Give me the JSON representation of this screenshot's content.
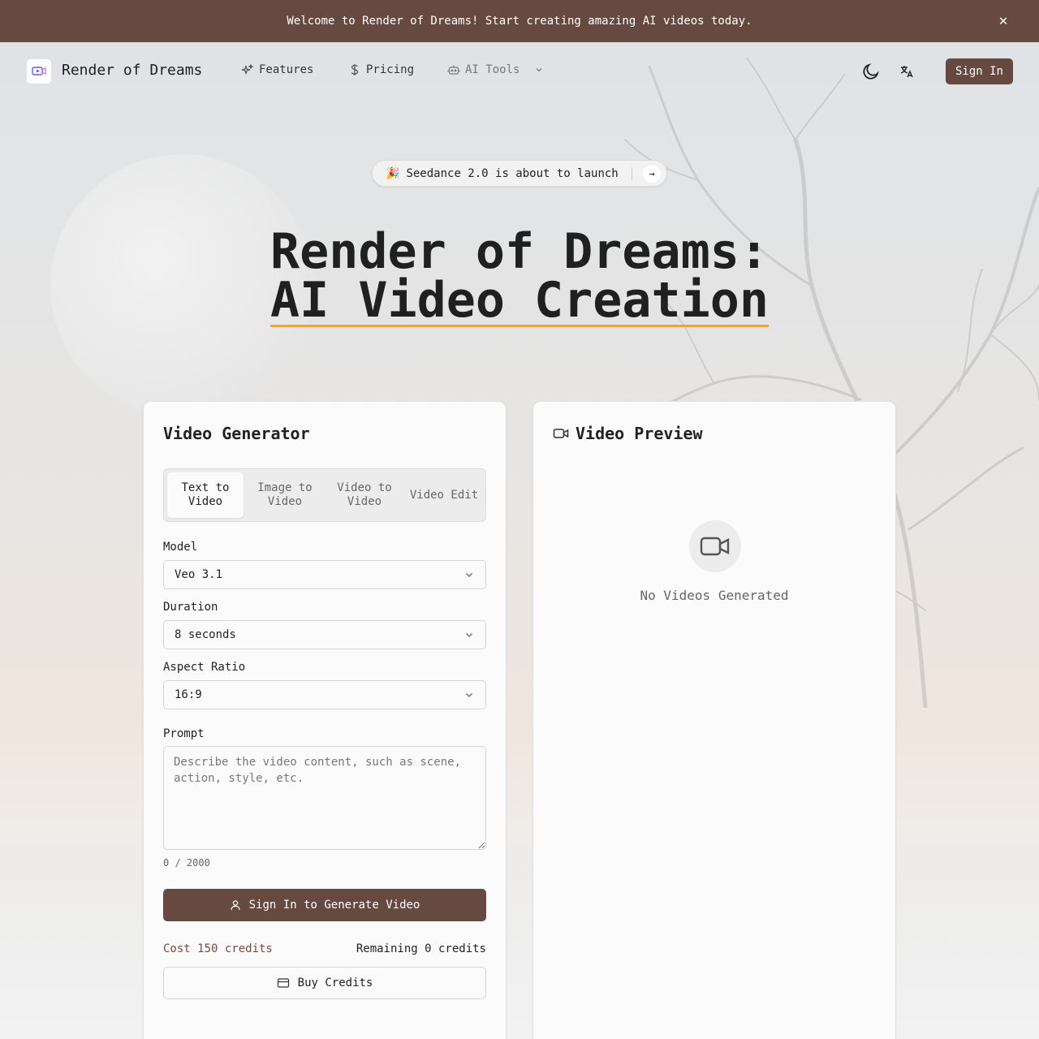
{
  "banner": {
    "message": "Welcome to Render of Dreams! Start creating amazing AI videos today.",
    "close_icon": "x-icon"
  },
  "nav": {
    "brand": "Render of Dreams",
    "items": [
      {
        "label": "Features",
        "icon": "sparkles-icon"
      },
      {
        "label": "Pricing",
        "icon": "dollar-icon"
      },
      {
        "label": "AI Tools",
        "icon": "bot-icon"
      }
    ],
    "sign_in": "Sign In",
    "theme_icon": "moon-icon",
    "language_icon": "translate-icon"
  },
  "announcement": {
    "emoji": "🎉",
    "text": "Seedance 2.0 is about to launch"
  },
  "hero": {
    "line1": "Render of Dreams:",
    "line2": "AI Video Creation",
    "underline_color": "#f0a431"
  },
  "generator": {
    "title": "Video Generator",
    "tabs": [
      {
        "label": "Text to Video",
        "active": true
      },
      {
        "label": "Image to Video",
        "active": false
      },
      {
        "label": "Video to Video",
        "active": false
      },
      {
        "label": "Video Edit",
        "active": false
      }
    ],
    "model": {
      "label": "Model",
      "value": "Veo 3.1"
    },
    "duration": {
      "label": "Duration",
      "value": "8 seconds"
    },
    "aspect_ratio": {
      "label": "Aspect Ratio",
      "value": "16:9"
    },
    "prompt": {
      "label": "Prompt",
      "value": "",
      "placeholder": "Describe the video content, such as scene, action, style, etc.",
      "counter": "0 / 2000"
    },
    "generate_button": "Sign In to Generate Video",
    "cost": "Cost 150 credits",
    "remaining": "Remaining 0 credits",
    "buy_button": "Buy Credits"
  },
  "preview": {
    "title": "Video Preview",
    "empty_text": "No Videos Generated"
  },
  "colors": {
    "brand": "#664a41",
    "accent": "#f0a431"
  }
}
